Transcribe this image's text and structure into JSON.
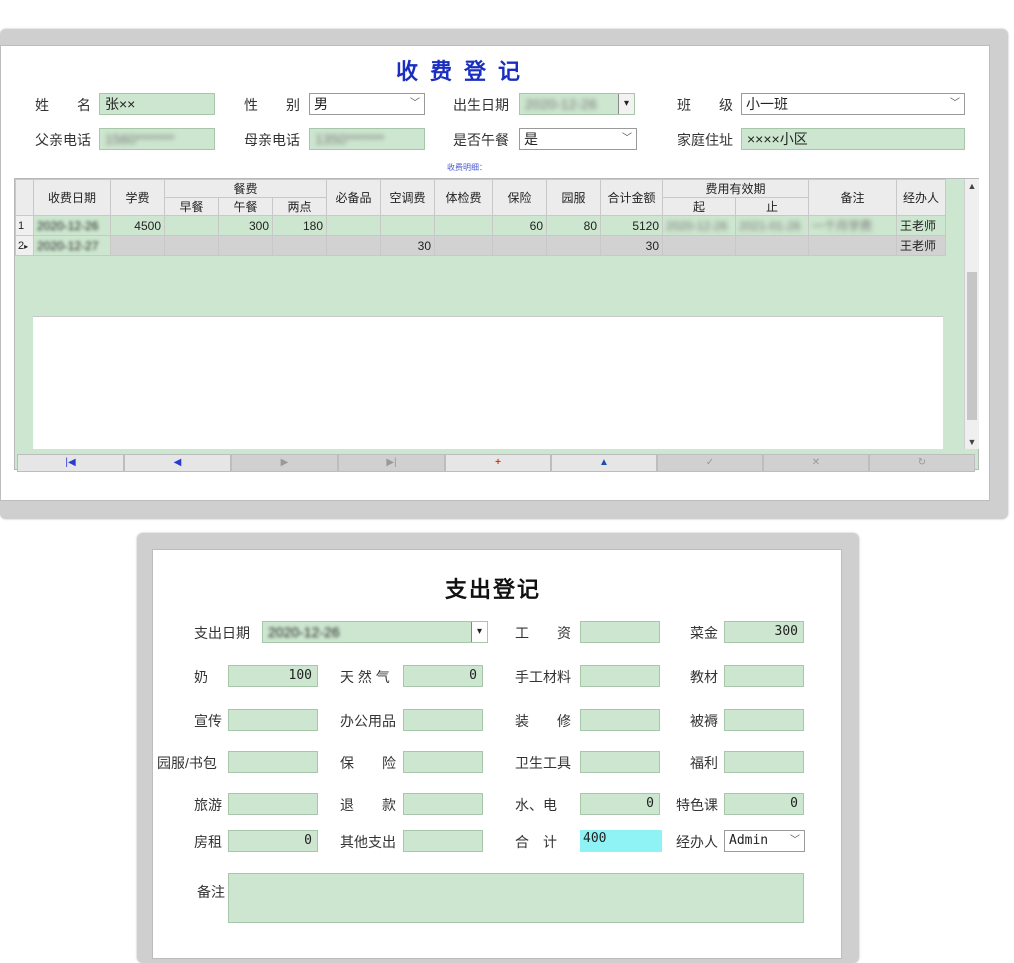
{
  "fee_form": {
    "title": "收费登记",
    "fields": {
      "name": {
        "label": "姓　　名",
        "value": "张××"
      },
      "gender": {
        "label": "性　　别",
        "value": "男"
      },
      "birth": {
        "label": "出生日期",
        "value": "2020-12-26"
      },
      "class": {
        "label": "班　　级",
        "value": "小一班"
      },
      "father_phone": {
        "label": "父亲电话",
        "value": "1560*******"
      },
      "mother_phone": {
        "label": "母亲电话",
        "value": "1350*******"
      },
      "lunch": {
        "label": "是否午餐",
        "value": "是"
      },
      "address": {
        "label": "家庭住址",
        "value": "××××小区"
      }
    },
    "detail_label": "收费明细：",
    "grid": {
      "headers": {
        "date": "收费日期",
        "tuition": "学费",
        "meal": "餐费",
        "breakfast": "早餐",
        "lunch": "午餐",
        "snack": "两点",
        "supplies": "必备品",
        "ac": "空调费",
        "checkup": "体检费",
        "insurance": "保险",
        "uniform": "园服",
        "total": "合计金额",
        "valid": "费用有效期",
        "from": "起",
        "to": "止",
        "remark": "备注",
        "handler": "经办人"
      },
      "rows": [
        {
          "idx": "1",
          "date": "2020-12-26",
          "tuition": "4500",
          "breakfast": "",
          "lunch": "300",
          "snack": "180",
          "supplies": "",
          "ac": "",
          "checkup": "",
          "insurance": "60",
          "uniform": "80",
          "total": "5120",
          "from": "2020-12-26",
          "to": "2021-01-26",
          "remark": "一个月学费",
          "handler": "王老师"
        },
        {
          "idx": "2",
          "date": "2020-12-27",
          "tuition": "",
          "breakfast": "",
          "lunch": "",
          "snack": "",
          "supplies": "",
          "ac": "30",
          "checkup": "",
          "insurance": "",
          "uniform": "",
          "total": "30",
          "from": "",
          "to": "",
          "remark": "",
          "handler": "王老师"
        }
      ]
    },
    "nav": [
      "|◀",
      "◀",
      "▶",
      "▶|",
      "+",
      "▲",
      "✓",
      "✕",
      "↻"
    ]
  },
  "expense_form": {
    "title": "支出登记",
    "fields": {
      "date": {
        "label": "支出日期",
        "value": "2020-12-26"
      },
      "salary": {
        "label": "工　　资",
        "value": ""
      },
      "vegetables": {
        "label": "菜金",
        "value": "300"
      },
      "milk": {
        "label": "奶",
        "value": "100"
      },
      "gas": {
        "label": "天 然 气",
        "value": "0"
      },
      "craft": {
        "label": "手工材料",
        "value": ""
      },
      "textbook": {
        "label": "教材",
        "value": ""
      },
      "promo": {
        "label": "宣传",
        "value": ""
      },
      "office": {
        "label": "办公用品",
        "value": ""
      },
      "decor": {
        "label": "装　　修",
        "value": ""
      },
      "bedding": {
        "label": "被褥",
        "value": ""
      },
      "uniform_bag": {
        "label": "园服/书包",
        "value": ""
      },
      "insurance": {
        "label": "保　　险",
        "value": ""
      },
      "hygiene": {
        "label": "卫生工具",
        "value": ""
      },
      "welfare": {
        "label": "福利",
        "value": ""
      },
      "travel": {
        "label": "旅游",
        "value": ""
      },
      "refund": {
        "label": "退　　款",
        "value": ""
      },
      "utilities": {
        "label": "水、电",
        "value": "0"
      },
      "special": {
        "label": "特色课",
        "value": "0"
      },
      "rent": {
        "label": "房租",
        "value": "0"
      },
      "other": {
        "label": "其他支出",
        "value": ""
      },
      "total": {
        "label": "合　计",
        "value": "400"
      },
      "handler": {
        "label": "经办人",
        "value": "Admin"
      },
      "remark": {
        "label": "备注",
        "value": ""
      }
    }
  },
  "colors": {
    "title_blue": "#1a2fc0",
    "field_green": "#cde6cf",
    "highlight_cyan": "#8ff2f5",
    "frame_gray": "#cfcfcf"
  }
}
